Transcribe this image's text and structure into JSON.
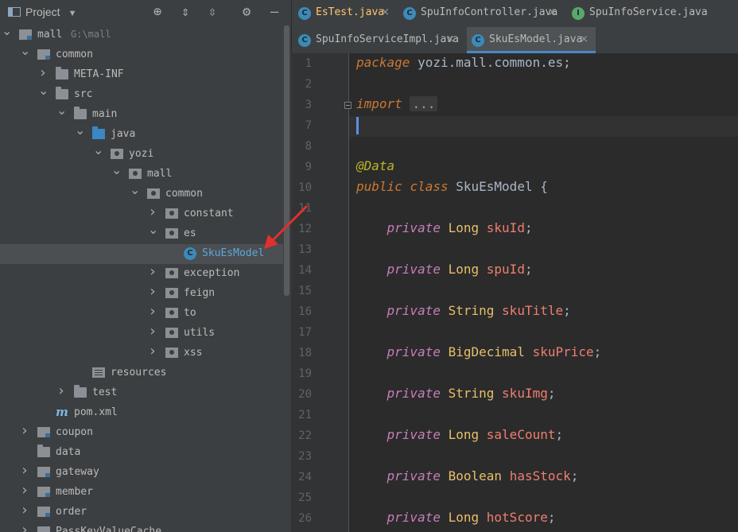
{
  "project_panel": {
    "title": "Project",
    "tree": [
      {
        "label": "mall",
        "hint": "G:\\mall",
        "depth": 0,
        "arrow": "down",
        "icon": "module"
      },
      {
        "label": "common",
        "depth": 1,
        "arrow": "down",
        "icon": "module"
      },
      {
        "label": "META-INF",
        "depth": 2,
        "arrow": "right",
        "icon": "folder"
      },
      {
        "label": "src",
        "depth": 2,
        "arrow": "down",
        "icon": "folder"
      },
      {
        "label": "main",
        "depth": 3,
        "arrow": "down",
        "icon": "folder"
      },
      {
        "label": "java",
        "depth": 4,
        "arrow": "down",
        "icon": "src"
      },
      {
        "label": "yozi",
        "depth": 5,
        "arrow": "down",
        "icon": "pkg"
      },
      {
        "label": "mall",
        "depth": 6,
        "arrow": "down",
        "icon": "pkg"
      },
      {
        "label": "common",
        "depth": 7,
        "arrow": "down",
        "icon": "pkg"
      },
      {
        "label": "constant",
        "depth": 8,
        "arrow": "right",
        "icon": "pkg"
      },
      {
        "label": "es",
        "depth": 8,
        "arrow": "down",
        "icon": "pkg"
      },
      {
        "label": "SkuEsModel",
        "depth": 9,
        "arrow": "none",
        "icon": "class",
        "selected": true
      },
      {
        "label": "exception",
        "depth": 8,
        "arrow": "right",
        "icon": "pkg"
      },
      {
        "label": "feign",
        "depth": 8,
        "arrow": "right",
        "icon": "pkg"
      },
      {
        "label": "to",
        "depth": 8,
        "arrow": "right",
        "icon": "pkg"
      },
      {
        "label": "utils",
        "depth": 8,
        "arrow": "right",
        "icon": "pkg"
      },
      {
        "label": "xss",
        "depth": 8,
        "arrow": "right",
        "icon": "pkg"
      },
      {
        "label": "resources",
        "depth": 4,
        "arrow": "none",
        "icon": "res"
      },
      {
        "label": "test",
        "depth": 3,
        "arrow": "right",
        "icon": "folder"
      },
      {
        "label": "pom.xml",
        "depth": 2,
        "arrow": "none",
        "icon": "maven"
      },
      {
        "label": "coupon",
        "depth": 1,
        "arrow": "right",
        "icon": "module"
      },
      {
        "label": "data",
        "depth": 1,
        "arrow": "none",
        "icon": "folder"
      },
      {
        "label": "gateway",
        "depth": 1,
        "arrow": "right",
        "icon": "module"
      },
      {
        "label": "member",
        "depth": 1,
        "arrow": "right",
        "icon": "module"
      },
      {
        "label": "order",
        "depth": 1,
        "arrow": "right",
        "icon": "module"
      },
      {
        "label": "PassKeyValueCache",
        "depth": 1,
        "arrow": "right",
        "icon": "module"
      }
    ]
  },
  "tabs": {
    "row1": [
      {
        "label": "EsTest.java",
        "icon": "C",
        "icon_color": "#3d8ab8",
        "text_color": "#ffc66d"
      },
      {
        "label": "SpuInfoController.java",
        "icon": "C",
        "icon_color": "#3d8ab8",
        "text_color": "#bbbbbb"
      },
      {
        "label": "SpuInfoService.java",
        "icon": "I",
        "icon_color": "#59a869",
        "text_color": "#bbbbbb"
      }
    ],
    "row2": [
      {
        "label": "SpuInfoServiceImpl.java",
        "icon": "C",
        "icon_color": "#3d8ab8",
        "text_color": "#bbbbbb"
      },
      {
        "label": "SkuEsModel.java",
        "icon": "C",
        "icon_color": "#3d8ab8",
        "text_color": "#bbbbbb",
        "active": true
      }
    ]
  },
  "editor": {
    "line_numbers": [
      "1",
      "2",
      "3",
      "7",
      "8",
      "9",
      "10",
      "11",
      "12",
      "13",
      "14",
      "15",
      "16",
      "17",
      "18",
      "19",
      "20",
      "21",
      "22",
      "23",
      "24",
      "25",
      "26"
    ],
    "package_kw": "package",
    "package_name": "yozi.mall.common.es",
    "import_kw": "import",
    "import_folded": "...",
    "annotation": "@Data",
    "class_decl": {
      "public": "public",
      "class": "class",
      "name": "SkuEsModel",
      "brace": "{"
    },
    "fields": [
      {
        "mod": "private",
        "type": "Long",
        "name": "skuId"
      },
      {
        "mod": "private",
        "type": "Long",
        "name": "spuId"
      },
      {
        "mod": "private",
        "type": "String",
        "name": "skuTitle"
      },
      {
        "mod": "private",
        "type": "BigDecimal",
        "name": "skuPrice"
      },
      {
        "mod": "private",
        "type": "String",
        "name": "skuImg"
      },
      {
        "mod": "private",
        "type": "Long",
        "name": "saleCount"
      },
      {
        "mod": "private",
        "type": "Boolean",
        "name": "hasStock"
      },
      {
        "mod": "private",
        "type": "Long",
        "name": "hotScore"
      }
    ]
  }
}
